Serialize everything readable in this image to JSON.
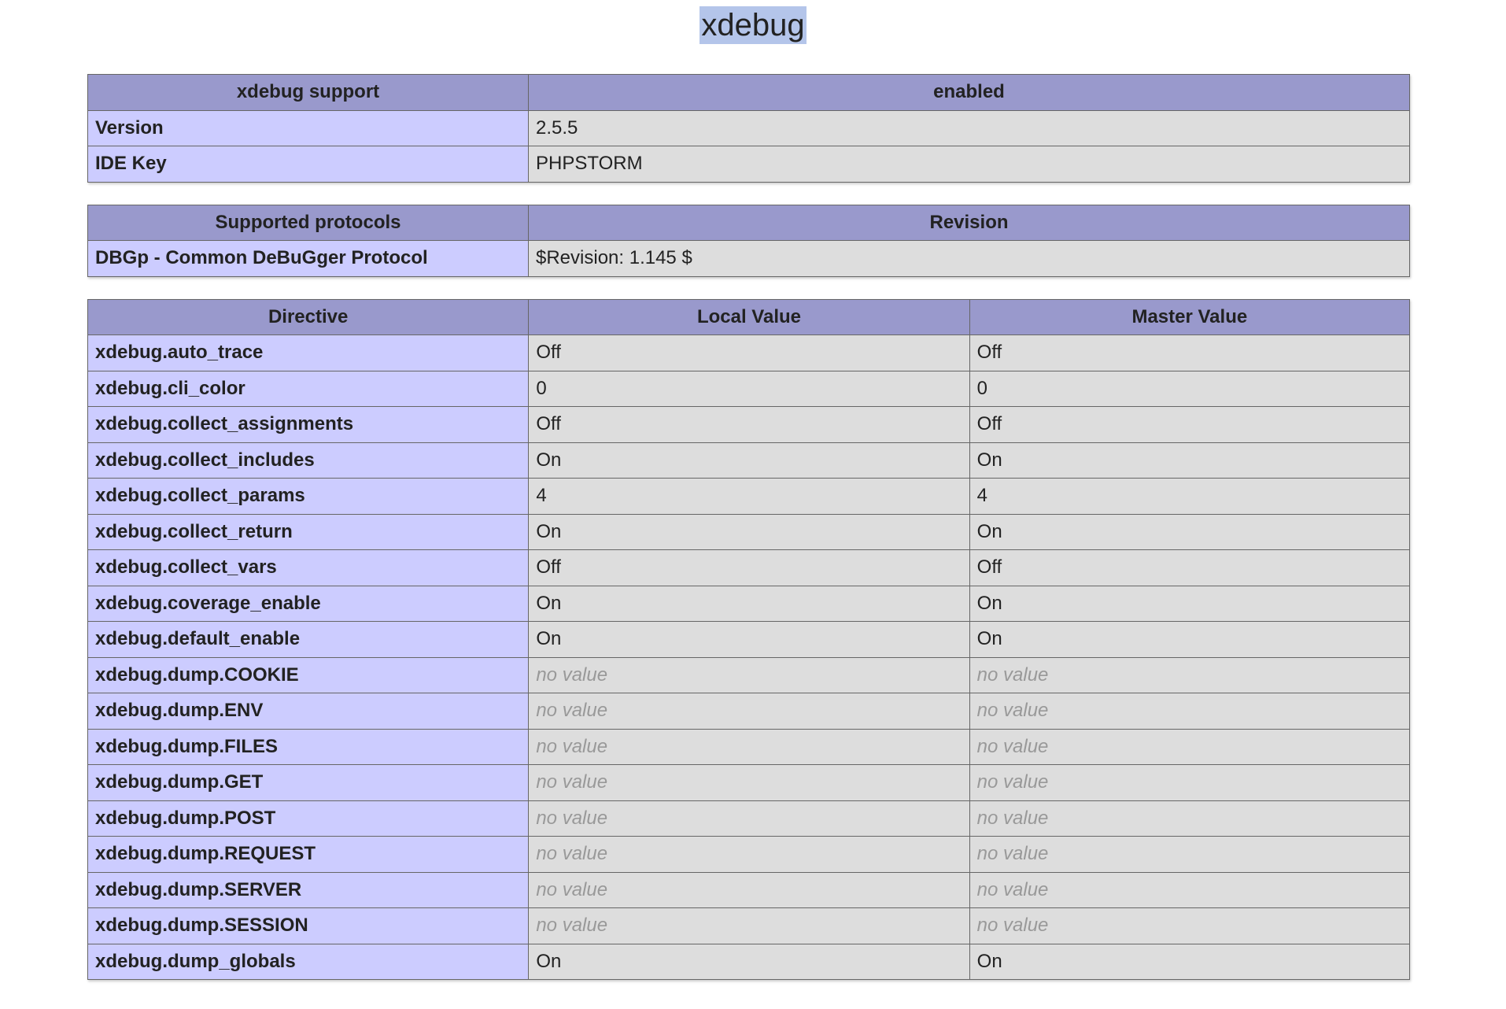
{
  "page": {
    "title": "xdebug"
  },
  "support_table": {
    "header": [
      "xdebug support",
      "enabled"
    ],
    "rows": [
      {
        "key": "Version",
        "value": "2.5.5"
      },
      {
        "key": "IDE Key",
        "value": "PHPSTORM"
      }
    ]
  },
  "protocols_table": {
    "header": [
      "Supported protocols",
      "Revision"
    ],
    "rows": [
      {
        "key": "DBGp - Common DeBuGger Protocol",
        "value": "$Revision: 1.145 $"
      }
    ]
  },
  "directives_table": {
    "header": [
      "Directive",
      "Local Value",
      "Master Value"
    ],
    "rows": [
      {
        "directive": "xdebug.auto_trace",
        "local": "Off",
        "master": "Off"
      },
      {
        "directive": "xdebug.cli_color",
        "local": "0",
        "master": "0"
      },
      {
        "directive": "xdebug.collect_assignments",
        "local": "Off",
        "master": "Off"
      },
      {
        "directive": "xdebug.collect_includes",
        "local": "On",
        "master": "On"
      },
      {
        "directive": "xdebug.collect_params",
        "local": "4",
        "master": "4"
      },
      {
        "directive": "xdebug.collect_return",
        "local": "On",
        "master": "On"
      },
      {
        "directive": "xdebug.collect_vars",
        "local": "Off",
        "master": "Off"
      },
      {
        "directive": "xdebug.coverage_enable",
        "local": "On",
        "master": "On"
      },
      {
        "directive": "xdebug.default_enable",
        "local": "On",
        "master": "On"
      },
      {
        "directive": "xdebug.dump.COOKIE",
        "local": "no value",
        "master": "no value"
      },
      {
        "directive": "xdebug.dump.ENV",
        "local": "no value",
        "master": "no value"
      },
      {
        "directive": "xdebug.dump.FILES",
        "local": "no value",
        "master": "no value"
      },
      {
        "directive": "xdebug.dump.GET",
        "local": "no value",
        "master": "no value"
      },
      {
        "directive": "xdebug.dump.POST",
        "local": "no value",
        "master": "no value"
      },
      {
        "directive": "xdebug.dump.REQUEST",
        "local": "no value",
        "master": "no value"
      },
      {
        "directive": "xdebug.dump.SERVER",
        "local": "no value",
        "master": "no value"
      },
      {
        "directive": "xdebug.dump.SESSION",
        "local": "no value",
        "master": "no value"
      },
      {
        "directive": "xdebug.dump_globals",
        "local": "On",
        "master": "On"
      }
    ]
  }
}
